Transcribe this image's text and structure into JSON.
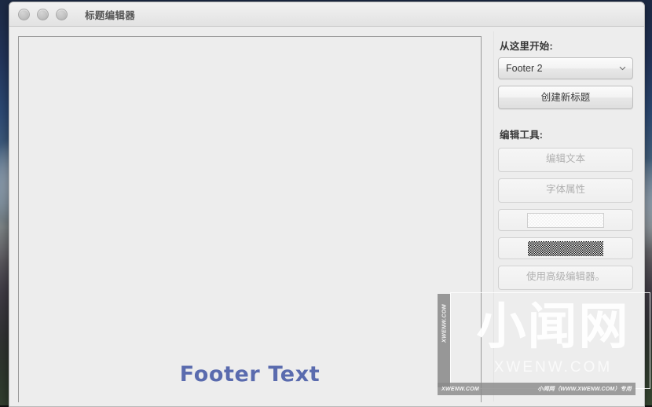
{
  "window": {
    "title": "标题编辑器",
    "traffic_lights": [
      "close-dot",
      "minimize-dot",
      "zoom-dot"
    ]
  },
  "canvas": {
    "footer_text": "Footer Text",
    "footer_text_color": "#5a6bae"
  },
  "sidebar": {
    "start_label": "从这里开始:",
    "template_select": {
      "value": "Footer 2",
      "icon": "chevron-down-icon"
    },
    "create_button": "创建新标题",
    "tools_label": "编辑工具:",
    "tools": [
      {
        "label": "编辑文本",
        "type": "text",
        "enabled": false
      },
      {
        "label": "字体属性",
        "type": "text",
        "enabled": false
      },
      {
        "label": "",
        "type": "swatch-light",
        "enabled": false
      },
      {
        "label": "",
        "type": "swatch-checker",
        "enabled": false
      },
      {
        "label": "使用高级编辑器。",
        "type": "text",
        "enabled": false
      }
    ]
  },
  "watermark": {
    "brand": "小闻网",
    "domain": "XWENW.COM",
    "vertical_text": "XWENW.COM",
    "bar_left": "XWENW.COM",
    "bar_right": "小闻网（WWW.XWENW.COM）专用"
  }
}
